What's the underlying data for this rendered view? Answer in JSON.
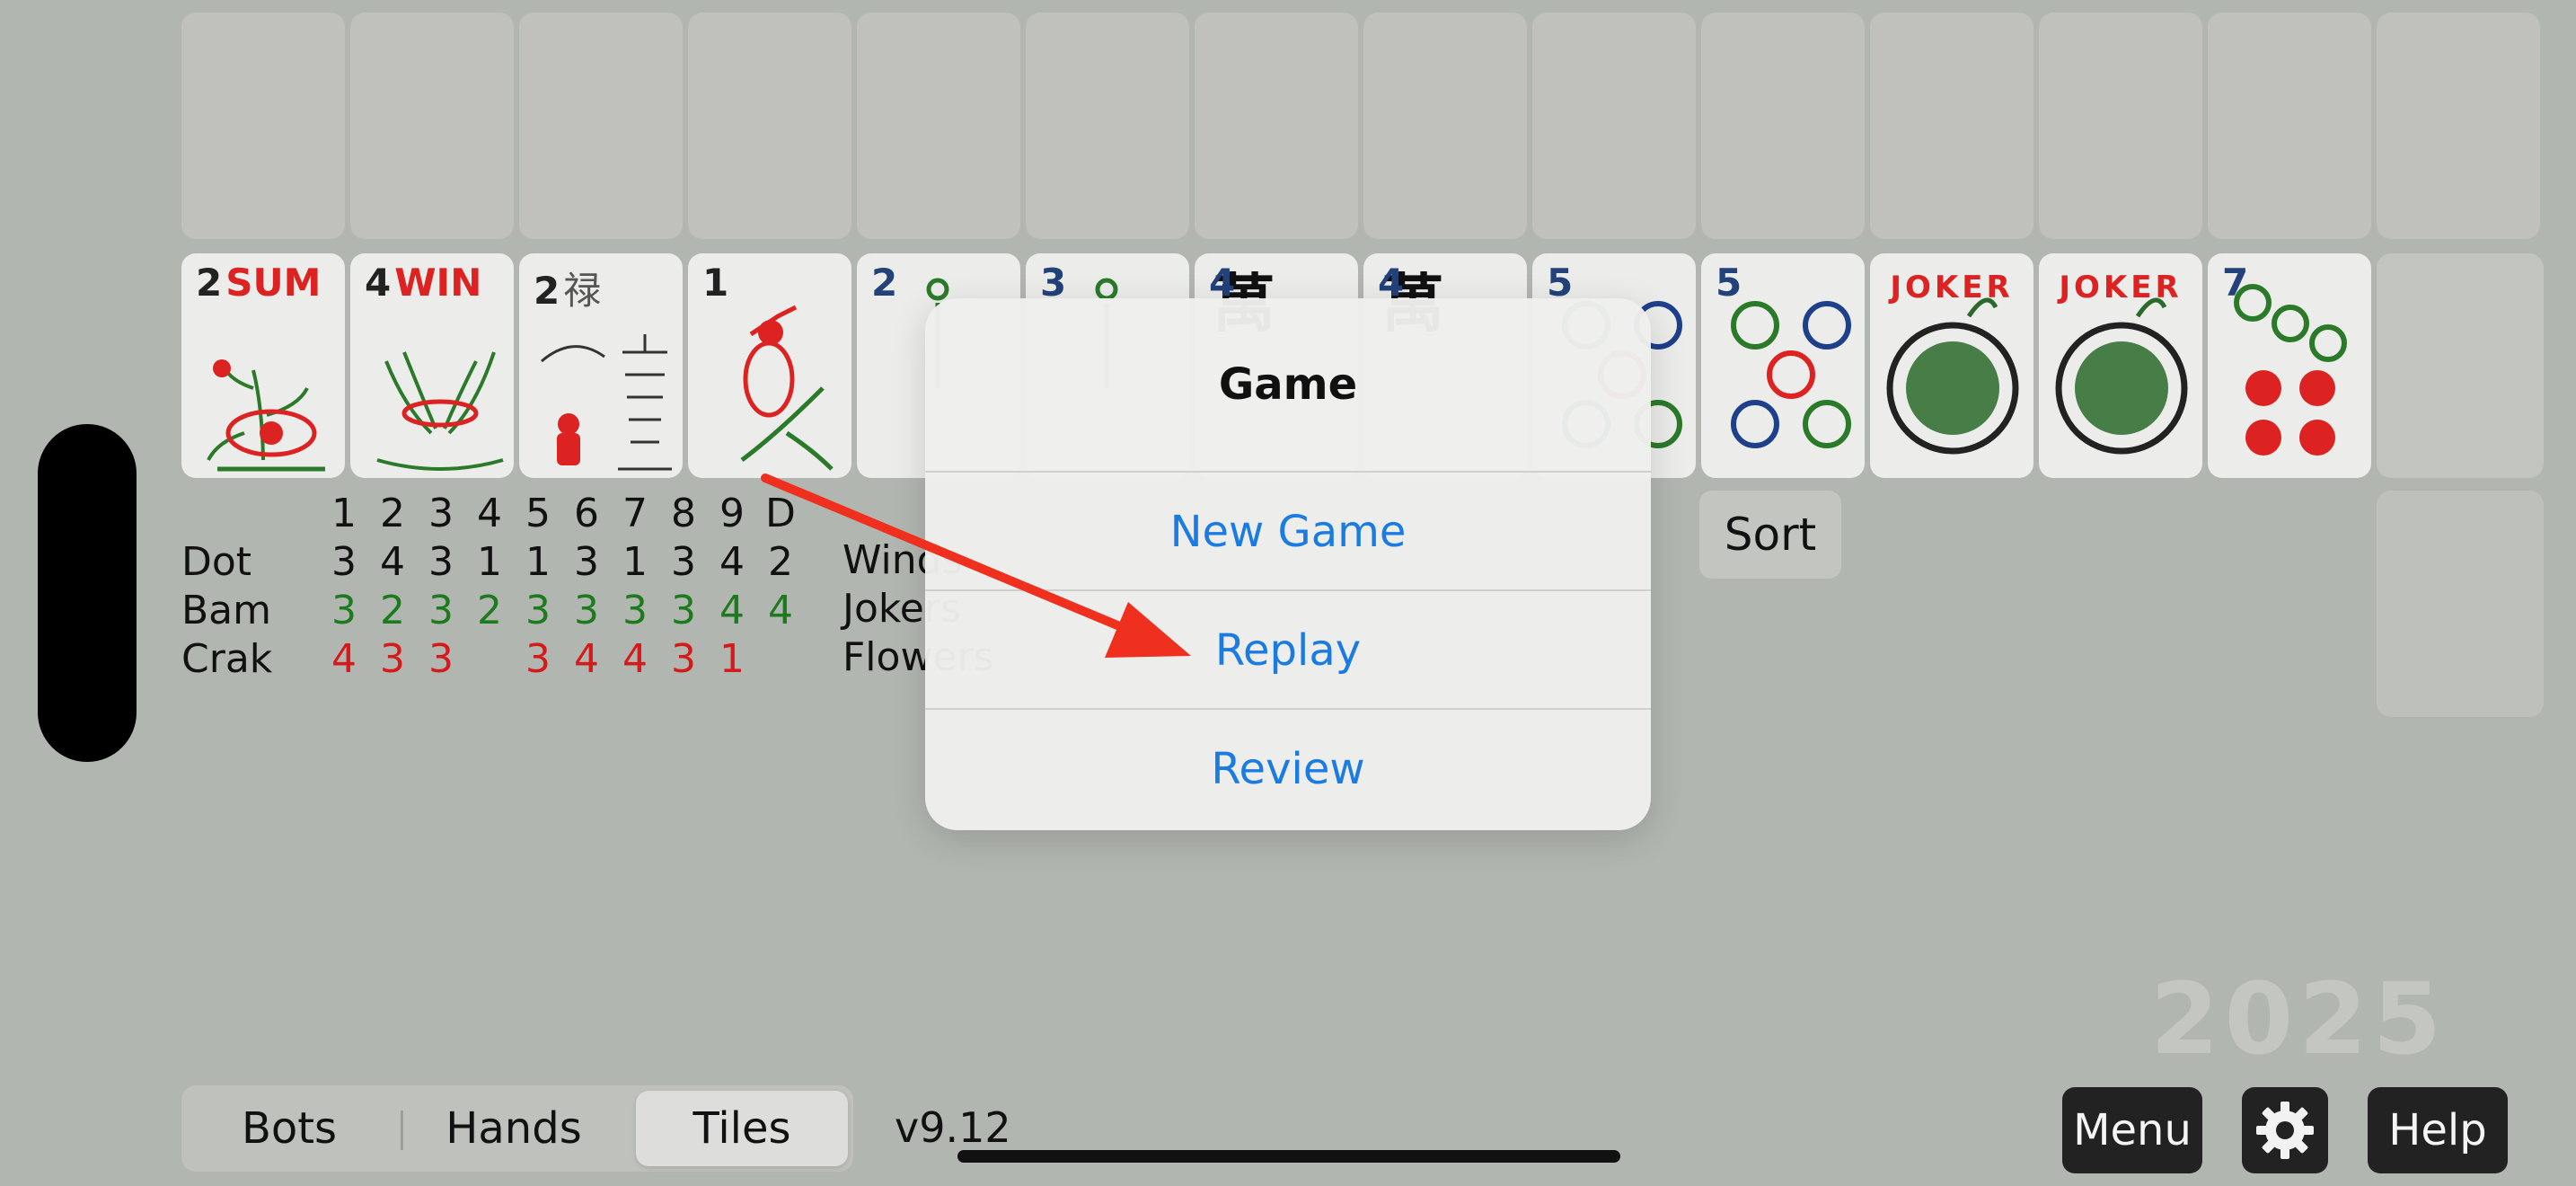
{
  "tiles": [
    {
      "num": "2",
      "word": "SUM",
      "word_color": "red"
    },
    {
      "num": "4",
      "word": "WIN",
      "word_color": "red"
    },
    {
      "num": "2",
      "word": "禄",
      "word_color": "gray"
    },
    {
      "num": "1",
      "word": "",
      "word_color": "red"
    },
    {
      "num": "2",
      "word": "",
      "word_color": "blue"
    },
    {
      "num": "3",
      "word": "",
      "word_color": "blue"
    },
    {
      "num": "4",
      "word": "",
      "word_color": "blue"
    },
    {
      "num": "4",
      "word": "",
      "word_color": "blue"
    },
    {
      "num": "5",
      "word": "",
      "word_color": "blue"
    },
    {
      "num": "5",
      "word": "",
      "word_color": "blue"
    },
    {
      "num": "",
      "word": "JOKER",
      "word_color": "red"
    },
    {
      "num": "",
      "word": "JOKER",
      "word_color": "red"
    },
    {
      "num": "7",
      "word": "",
      "word_color": "blue"
    }
  ],
  "stats": {
    "headers": [
      "1",
      "2",
      "3",
      "4",
      "5",
      "6",
      "7",
      "8",
      "9",
      "D"
    ],
    "rows": [
      {
        "label": "Dot",
        "values": [
          "3",
          "4",
          "3",
          "1",
          "1",
          "3",
          "1",
          "3",
          "4",
          "2"
        ],
        "color": "black"
      },
      {
        "label": "Bam",
        "values": [
          "3",
          "2",
          "3",
          "2",
          "3",
          "3",
          "3",
          "3",
          "4",
          "4"
        ],
        "color": "green"
      },
      {
        "label": "Crak",
        "values": [
          "4",
          "3",
          "3",
          "",
          "3",
          "4",
          "4",
          "3",
          "1",
          ""
        ],
        "color": "red"
      }
    ],
    "side_labels": [
      "Winds",
      "Jokers",
      "Flowers"
    ]
  },
  "sort_label": "Sort",
  "year_watermark": "2025",
  "bottom_bar": {
    "segments": [
      "Bots",
      "Hands",
      "Tiles"
    ],
    "active_segment": "Tiles",
    "version": "v9.12",
    "menu_label": "Menu",
    "help_label": "Help"
  },
  "dialog": {
    "title": "Game",
    "options": [
      "New Game",
      "Replay",
      "Review"
    ]
  },
  "colors": {
    "background": "#b2b6b0",
    "tile_face": "#ecedeb",
    "link_blue": "#1a7be3",
    "arrow_red": "#f0301e",
    "bam_green": "#1e7a1e",
    "crak_red": "#d41b1b"
  },
  "icons": {
    "settings": "gear-icon",
    "annotation": "red-arrow-icon"
  }
}
